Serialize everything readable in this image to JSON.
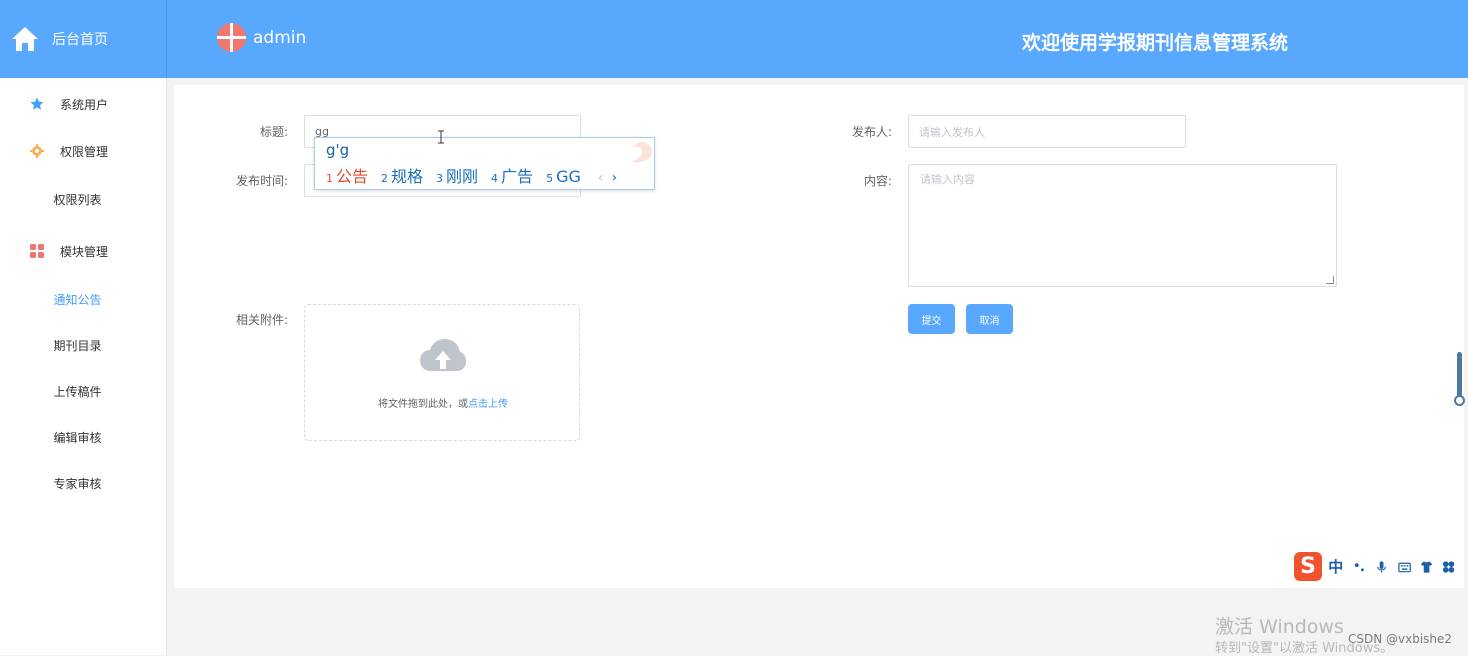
{
  "header": {
    "home_label": "后台首页",
    "username": "admin",
    "welcome": "欢迎使用学报期刊信息管理系统"
  },
  "sidebar": {
    "items": [
      {
        "label": "系统用户",
        "icon": "star-icon"
      },
      {
        "label": "权限管理",
        "icon": "gear-icon"
      },
      {
        "label": "权限列表"
      },
      {
        "label": "模块管理",
        "icon": "grid-icon"
      },
      {
        "label": "通知公告",
        "active": true
      },
      {
        "label": "期刊目录"
      },
      {
        "label": "上传稿件"
      },
      {
        "label": "编辑审核"
      },
      {
        "label": "专家审核"
      }
    ]
  },
  "form": {
    "title_label": "标题:",
    "title_value": "gg",
    "publish_time_label": "发布时间:",
    "publisher_label": "发布人:",
    "publisher_placeholder": "请输入发布人",
    "content_label": "内容:",
    "content_placeholder": "请输入内容",
    "attachment_label": "相关附件:",
    "upload_text": "将文件拖到此处，或",
    "upload_link": "点击上传",
    "submit_label": "提交",
    "cancel_label": "取消"
  },
  "ime_popup": {
    "pinyin": "g'g",
    "candidates": [
      {
        "num": "1",
        "text": "公告"
      },
      {
        "num": "2",
        "text": "规格"
      },
      {
        "num": "3",
        "text": "刚刚"
      },
      {
        "num": "4",
        "text": "广告"
      },
      {
        "num": "5",
        "text": "GG"
      }
    ],
    "prev": "‹",
    "next": "›"
  },
  "ime_toolbar": {
    "logo": "S",
    "mode": "中"
  },
  "watermarks": {
    "windows_line1": "激活 Windows",
    "windows_line2": "转到\"设置\"以激活 Windows。",
    "csdn": "CSDN @vxbishe2"
  },
  "colors": {
    "header_bg": "#58a8ff",
    "accent": "#409eff",
    "button": "#58a8ff"
  }
}
